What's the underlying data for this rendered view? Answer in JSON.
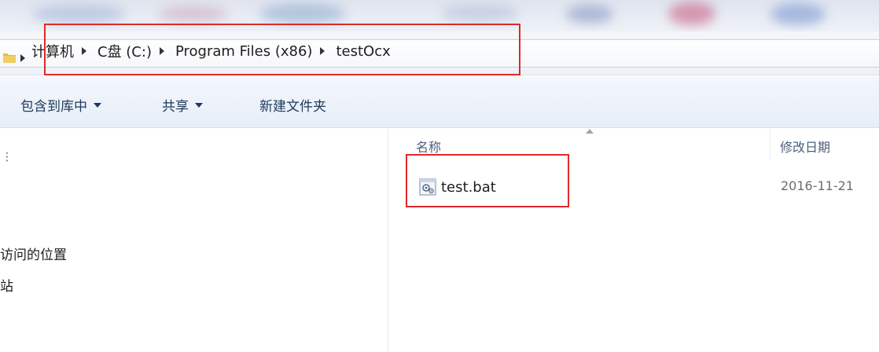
{
  "address": {
    "breadcrumbs": [
      "计算机",
      "C盘 (C:)",
      "Program Files (x86)",
      "testOcx"
    ]
  },
  "toolbar": {
    "include_library": "包含到库中",
    "share": "共享",
    "new_folder": "新建文件夹"
  },
  "nav": {
    "items": [
      "访问的位置",
      "站"
    ]
  },
  "columns": {
    "name": "名称",
    "modified": "修改日期"
  },
  "files": [
    {
      "name": "test.bat",
      "modified": "2016-11-21",
      "icon": "batch-file-icon"
    }
  ],
  "colors": {
    "highlight": "#e0282c",
    "toolbar_text": "#1e395b",
    "header_text": "#4c607a"
  }
}
